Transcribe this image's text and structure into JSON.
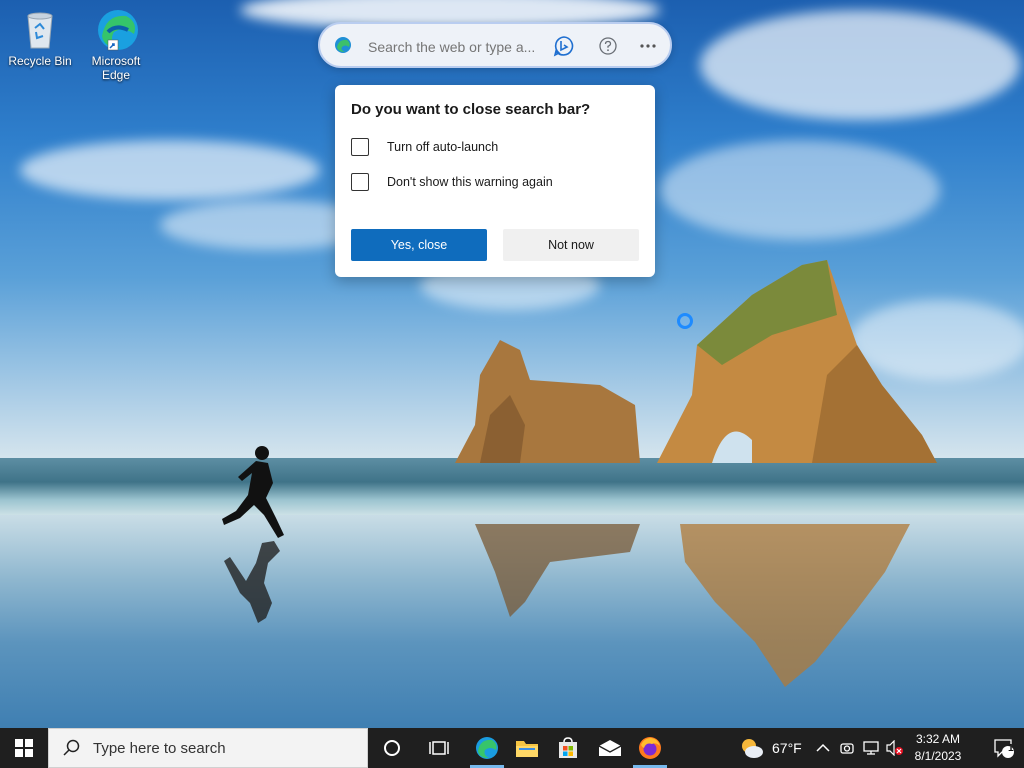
{
  "desktop": {
    "icons": [
      {
        "label": "Recycle Bin"
      },
      {
        "label": "Microsoft Edge"
      }
    ]
  },
  "searchbar": {
    "placeholder": "Search the web or type a..."
  },
  "dialog": {
    "title": "Do you want to close search bar?",
    "option1": "Turn off auto-launch",
    "option2": "Don't show this warning again",
    "primary_button": "Yes, close",
    "secondary_button": "Not now"
  },
  "taskbar": {
    "search_placeholder": "Type here to search",
    "weather": "67°F",
    "time": "3:32 AM",
    "date": "8/1/2023",
    "notification_count": "1"
  },
  "colors": {
    "accent": "#0f6cbd",
    "taskbar": "#1f1f1f"
  }
}
